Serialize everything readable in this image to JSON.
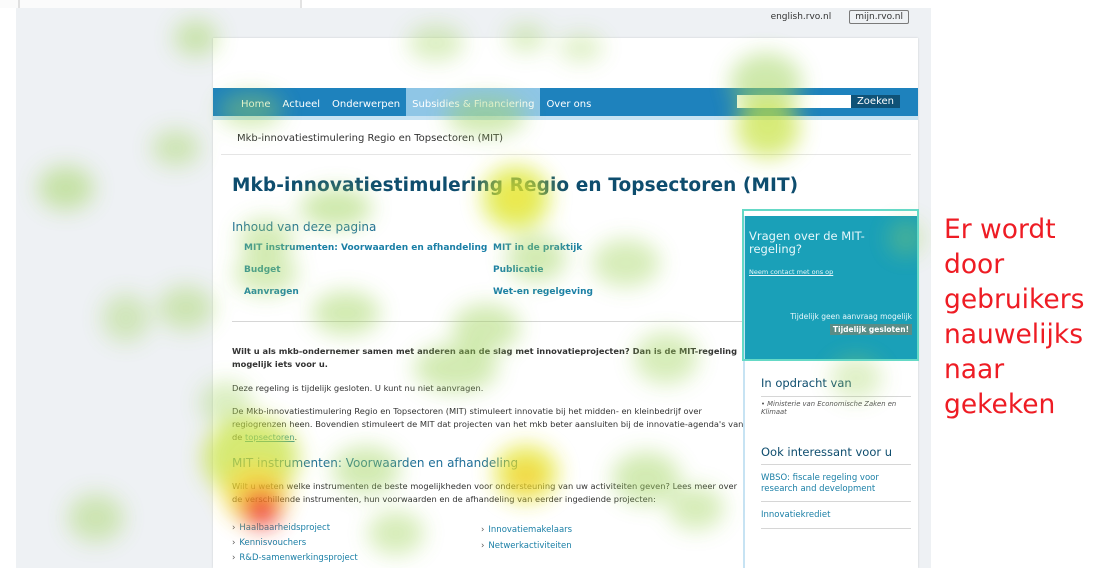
{
  "top_links": {
    "english": "english.rvo.nl",
    "mijn": "mijn.rvo.nl"
  },
  "nav": {
    "items": [
      "Home",
      "Actueel",
      "Onderwerpen",
      "Subsidies & Financiering",
      "Over ons"
    ],
    "active_index": 3,
    "search_button": "Zoeken"
  },
  "breadcrumb": "Mkb-innovatiestimulering Regio en Topsectoren (MIT)",
  "title": "Mkb-innovatiestimulering Regio en Topsectoren (MIT)",
  "toc": {
    "heading": "Inhoud van deze pagina",
    "left": [
      "MIT instrumenten: Voorwaarden en afhandeling",
      "Budget",
      "Aanvragen"
    ],
    "right": [
      "MIT in de praktijk",
      "Publicatie",
      "Wet-en regelgeving"
    ]
  },
  "intro": "Wilt u als mkb-ondernemer samen met anderen aan de slag met innovatieprojecten? Dan is de MIT-regeling mogelijk iets voor u.",
  "p1": "Deze regeling is tijdelijk gesloten. U kunt nu niet aanvragen.",
  "p2_text": "De Mkb-innovatiestimulering Regio en Topsectoren (MIT) stimuleert innovatie bij het midden- en kleinbedrijf over regiogrenzen heen. Bovendien stimuleert de MIT dat projecten van het mkb beter aansluiten bij de innovatie-agenda's van de ",
  "p2_link": "topsectoren",
  "p2_end": ".",
  "section2": {
    "heading": "MIT instrumenten: Voorwaarden en afhandeling",
    "text": "Wilt u weten welke instrumenten de beste mogelijkheden voor ondersteuning van uw activiteiten geven? Lees meer over de verschillende instrumenten, hun voorwaarden en de afhandeling van eerder ingediende projecten:",
    "list_left": [
      "Haalbaarheidsproject",
      "Kennisvouchers",
      "R&D-samenwerkingsproject"
    ],
    "list_right": [
      "Innovatiemakelaars",
      "Netwerkactiviteiten"
    ]
  },
  "sidebar": {
    "box_heading": "Vragen over de MIT-regeling?",
    "box_link": "Neem contact met ons op",
    "box_note": "Tijdelijk geen aanvraag mogelijk",
    "box_badge": "Tijdelijk gesloten!",
    "commission_heading": "In opdracht van",
    "commission_items": [
      "Ministerie van Economische Zaken en Klimaat"
    ],
    "interest_heading": "Ook interessant voor u",
    "interest_links": [
      "WBSO: fiscale regeling voor research and development",
      "Innovatiekrediet"
    ]
  },
  "annotation": "Er wordt door gebruikers nauwelijks naar gekeken",
  "colors": {
    "nav_blue": "#1e82bd",
    "title_navy": "#0e4d6e",
    "link_teal": "#1a7fa6",
    "sidebar_teal": "#1aa0b8",
    "annotation_red": "#ee1c24",
    "highlight_frame": "#65d9c6"
  }
}
